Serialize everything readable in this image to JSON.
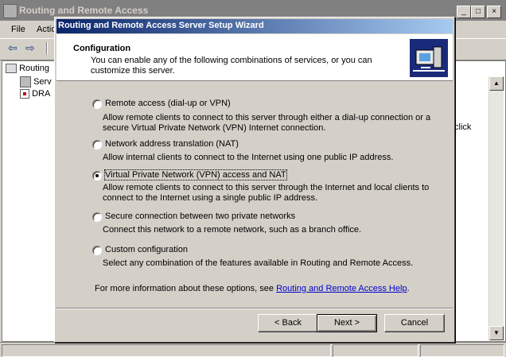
{
  "background_window": {
    "title": "Routing and Remote Access",
    "window_buttons": [
      "_",
      "□",
      "×"
    ],
    "menu": [
      "File",
      "Actio"
    ],
    "tree": [
      "Routing",
      "Serv",
      "DRA"
    ],
    "right_pane_fragments": [
      "click",
      "e."
    ]
  },
  "wizard": {
    "title": "Routing and Remote Access Server Setup Wizard",
    "header_title": "Configuration",
    "header_subtitle": "You can enable any of the following combinations of services, or you can customize this server.",
    "options": [
      {
        "label": "Remote access (dial-up or VPN)",
        "description": "Allow remote clients to connect to this server through either a dial-up connection or a secure Virtual Private Network (VPN) Internet connection.",
        "selected": false
      },
      {
        "label": "Network address translation (NAT)",
        "description": "Allow internal clients to connect to the Internet using one public IP address.",
        "selected": false
      },
      {
        "label": "Virtual Private Network (VPN) access and NAT",
        "description": "Allow remote clients to connect to this server through the Internet and local clients to connect to the Internet using a single public IP address.",
        "selected": true
      },
      {
        "label": "Secure connection between two private networks",
        "description": "Connect this network to a remote network, such as a branch office.",
        "selected": false
      },
      {
        "label": "Custom configuration",
        "description": "Select any combination of the features available in Routing and Remote Access.",
        "selected": false
      }
    ],
    "more_info_prefix": "For more information about these options, see ",
    "more_info_link": "Routing and Remote Access Help",
    "more_info_suffix": ".",
    "buttons": {
      "back": "< Back",
      "next": "Next >",
      "cancel": "Cancel"
    }
  },
  "colors": {
    "title_bar": "#0a246a",
    "link": "#0000cc",
    "dialog_face": "#d4d0c8"
  }
}
